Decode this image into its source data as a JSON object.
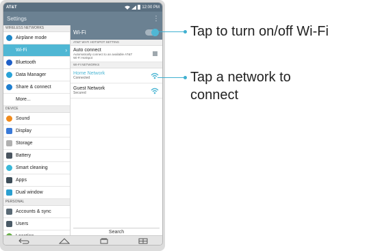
{
  "status_bar": {
    "carrier": "AT&T",
    "time": "12:00 PM"
  },
  "titlebar": {
    "title": "Settings"
  },
  "sidebar": {
    "sections": [
      {
        "label": "WIRELESS NETWORKS"
      },
      {
        "label": "DEVICE"
      },
      {
        "label": "PERSONAL"
      }
    ],
    "wireless": [
      {
        "label": "Airplane mode",
        "icon": "airplane-icon",
        "color": "#1e88c8"
      },
      {
        "label": "Wi-Fi",
        "icon": "wifi-icon",
        "color": "#4fb7d4",
        "active": true
      },
      {
        "label": "Bluetooth",
        "icon": "bluetooth-icon",
        "color": "#1e5fc8"
      },
      {
        "label": "Data Manager",
        "icon": "data-icon",
        "color": "#29a3d8"
      },
      {
        "label": "Share & connect",
        "icon": "share-icon",
        "color": "#1f7fd0"
      },
      {
        "label": "More...",
        "icon": "",
        "color": ""
      }
    ],
    "device": [
      {
        "label": "Sound",
        "icon": "sound-icon",
        "color": "#f08a1c"
      },
      {
        "label": "Display",
        "icon": "display-icon",
        "color": "#3a7ad8"
      },
      {
        "label": "Storage",
        "icon": "storage-icon",
        "color": "#b0b0b0"
      },
      {
        "label": "Battery",
        "icon": "battery-icon",
        "color": "#4a5560"
      },
      {
        "label": "Smart cleaning",
        "icon": "smart-cleaning-icon",
        "color": "#3ab8d8"
      },
      {
        "label": "Apps",
        "icon": "apps-icon",
        "color": "#3d4d58"
      },
      {
        "label": "Dual window",
        "icon": "dual-window-icon",
        "color": "#2a9fd0"
      }
    ],
    "personal": [
      {
        "label": "Accounts & sync",
        "icon": "accounts-icon",
        "color": "#5a6a75"
      },
      {
        "label": "Users",
        "icon": "users-icon",
        "color": "#4a5a66"
      },
      {
        "label": "Location",
        "icon": "location-icon",
        "color": "#6ab04a"
      }
    ]
  },
  "wifi_panel": {
    "title": "Wi-Fi",
    "hotspot_section": "AT&T WI-FI HOTSPOT SETTING",
    "auto_connect": {
      "title": "Auto connect",
      "subtitle": "Automatically connect to an available AT&T Wi-Fi HotSpot"
    },
    "networks_section": "WI-FI NETWORKS",
    "networks": [
      {
        "name": "Home Network",
        "status": "Connected",
        "highlight": true
      },
      {
        "name": "Guest Network",
        "status": "Secured",
        "highlight": false
      }
    ],
    "search_label": "Search"
  },
  "annotations": {
    "wifi_toggle": "Tap to turn on/off Wi-Fi",
    "network_tap_line1": "Tap a network to",
    "network_tap_line2": "connect"
  },
  "colors": {
    "accent": "#4fb7d4",
    "callout": "#3fb0d0",
    "header": "#6b8192"
  }
}
